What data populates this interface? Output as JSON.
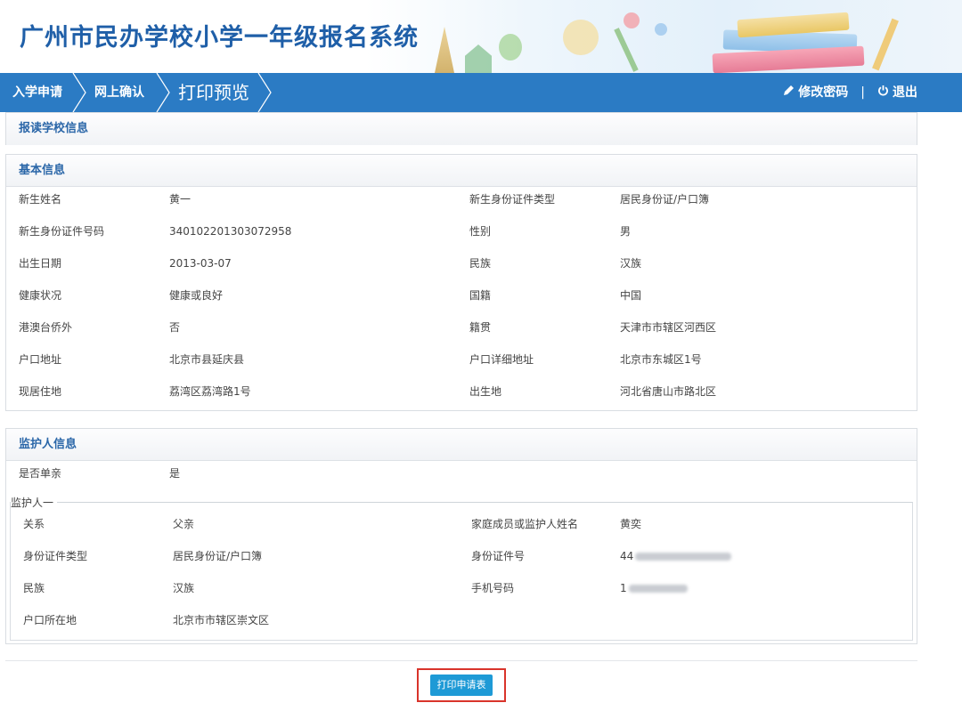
{
  "header": {
    "title": "广州市民办学校小学一年级报名系统"
  },
  "nav": {
    "steps": [
      "入学申请",
      "网上确认",
      "打印预览"
    ],
    "change_password": "修改密码",
    "divider": "|",
    "logout": "退出"
  },
  "school_section": {
    "title": "报读学校信息"
  },
  "basic_section": {
    "title": "基本信息",
    "rows": [
      {
        "l1": "新生姓名",
        "v1": "黄一",
        "l2": "新生身份证件类型",
        "v2": "居民身份证/户口簿"
      },
      {
        "l1": "新生身份证件号码",
        "v1": "340102201303072958",
        "l2": "性别",
        "v2": "男"
      },
      {
        "l1": "出生日期",
        "v1": "2013-03-07",
        "l2": "民族",
        "v2": "汉族"
      },
      {
        "l1": "健康状况",
        "v1": "健康或良好",
        "l2": "国籍",
        "v2": "中国"
      },
      {
        "l1": "港澳台侨外",
        "v1": "否",
        "l2": "籍贯",
        "v2": "天津市市辖区河西区"
      },
      {
        "l1": "户口地址",
        "v1": "北京市县延庆县",
        "l2": "户口详细地址",
        "v2": "北京市东城区1号"
      },
      {
        "l1": "现居住地",
        "v1": "荔湾区荔湾路1号",
        "l2": "出生地",
        "v2": "河北省唐山市路北区"
      }
    ]
  },
  "guardian_section": {
    "title": "监护人信息",
    "single_parent_label": "是否单亲",
    "single_parent_value": "是",
    "guardian1_caption": "监护人一",
    "rows": [
      {
        "l1": "关系",
        "v1": "父亲",
        "l2": "家庭成员或监护人姓名",
        "v2": "黄奕"
      },
      {
        "l1": "身份证件类型",
        "v1": "居民身份证/户口簿",
        "l2": "身份证件号",
        "v2": "44"
      },
      {
        "l1": "民族",
        "v1": "汉族",
        "l2": "手机号码",
        "v2": "1"
      },
      {
        "l1": "户口所在地",
        "v1": "北京市市辖区崇文区",
        "l2": "",
        "v2": ""
      }
    ]
  },
  "actions": {
    "print_label": "打印申请表"
  },
  "colors": {
    "nav_bg": "#2b7bc4",
    "title": "#1f5fa8",
    "section_title": "#2a66a8",
    "button": "#1e9ad6",
    "highlight": "#d9342b"
  }
}
